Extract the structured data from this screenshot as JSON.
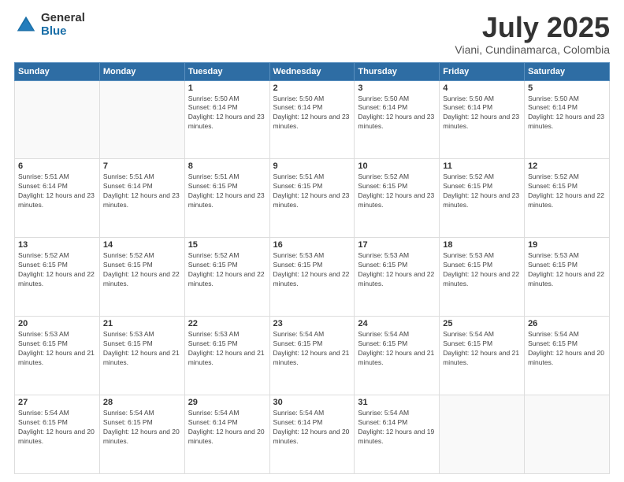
{
  "logo": {
    "general": "General",
    "blue": "Blue"
  },
  "header": {
    "title": "July 2025",
    "subtitle": "Viani, Cundinamarca, Colombia"
  },
  "weekdays": [
    "Sunday",
    "Monday",
    "Tuesday",
    "Wednesday",
    "Thursday",
    "Friday",
    "Saturday"
  ],
  "weeks": [
    [
      {
        "day": "",
        "info": ""
      },
      {
        "day": "",
        "info": ""
      },
      {
        "day": "1",
        "info": "Sunrise: 5:50 AM\nSunset: 6:14 PM\nDaylight: 12 hours and 23 minutes."
      },
      {
        "day": "2",
        "info": "Sunrise: 5:50 AM\nSunset: 6:14 PM\nDaylight: 12 hours and 23 minutes."
      },
      {
        "day": "3",
        "info": "Sunrise: 5:50 AM\nSunset: 6:14 PM\nDaylight: 12 hours and 23 minutes."
      },
      {
        "day": "4",
        "info": "Sunrise: 5:50 AM\nSunset: 6:14 PM\nDaylight: 12 hours and 23 minutes."
      },
      {
        "day": "5",
        "info": "Sunrise: 5:50 AM\nSunset: 6:14 PM\nDaylight: 12 hours and 23 minutes."
      }
    ],
    [
      {
        "day": "6",
        "info": "Sunrise: 5:51 AM\nSunset: 6:14 PM\nDaylight: 12 hours and 23 minutes."
      },
      {
        "day": "7",
        "info": "Sunrise: 5:51 AM\nSunset: 6:14 PM\nDaylight: 12 hours and 23 minutes."
      },
      {
        "day": "8",
        "info": "Sunrise: 5:51 AM\nSunset: 6:15 PM\nDaylight: 12 hours and 23 minutes."
      },
      {
        "day": "9",
        "info": "Sunrise: 5:51 AM\nSunset: 6:15 PM\nDaylight: 12 hours and 23 minutes."
      },
      {
        "day": "10",
        "info": "Sunrise: 5:52 AM\nSunset: 6:15 PM\nDaylight: 12 hours and 23 minutes."
      },
      {
        "day": "11",
        "info": "Sunrise: 5:52 AM\nSunset: 6:15 PM\nDaylight: 12 hours and 23 minutes."
      },
      {
        "day": "12",
        "info": "Sunrise: 5:52 AM\nSunset: 6:15 PM\nDaylight: 12 hours and 22 minutes."
      }
    ],
    [
      {
        "day": "13",
        "info": "Sunrise: 5:52 AM\nSunset: 6:15 PM\nDaylight: 12 hours and 22 minutes."
      },
      {
        "day": "14",
        "info": "Sunrise: 5:52 AM\nSunset: 6:15 PM\nDaylight: 12 hours and 22 minutes."
      },
      {
        "day": "15",
        "info": "Sunrise: 5:52 AM\nSunset: 6:15 PM\nDaylight: 12 hours and 22 minutes."
      },
      {
        "day": "16",
        "info": "Sunrise: 5:53 AM\nSunset: 6:15 PM\nDaylight: 12 hours and 22 minutes."
      },
      {
        "day": "17",
        "info": "Sunrise: 5:53 AM\nSunset: 6:15 PM\nDaylight: 12 hours and 22 minutes."
      },
      {
        "day": "18",
        "info": "Sunrise: 5:53 AM\nSunset: 6:15 PM\nDaylight: 12 hours and 22 minutes."
      },
      {
        "day": "19",
        "info": "Sunrise: 5:53 AM\nSunset: 6:15 PM\nDaylight: 12 hours and 22 minutes."
      }
    ],
    [
      {
        "day": "20",
        "info": "Sunrise: 5:53 AM\nSunset: 6:15 PM\nDaylight: 12 hours and 21 minutes."
      },
      {
        "day": "21",
        "info": "Sunrise: 5:53 AM\nSunset: 6:15 PM\nDaylight: 12 hours and 21 minutes."
      },
      {
        "day": "22",
        "info": "Sunrise: 5:53 AM\nSunset: 6:15 PM\nDaylight: 12 hours and 21 minutes."
      },
      {
        "day": "23",
        "info": "Sunrise: 5:54 AM\nSunset: 6:15 PM\nDaylight: 12 hours and 21 minutes."
      },
      {
        "day": "24",
        "info": "Sunrise: 5:54 AM\nSunset: 6:15 PM\nDaylight: 12 hours and 21 minutes."
      },
      {
        "day": "25",
        "info": "Sunrise: 5:54 AM\nSunset: 6:15 PM\nDaylight: 12 hours and 21 minutes."
      },
      {
        "day": "26",
        "info": "Sunrise: 5:54 AM\nSunset: 6:15 PM\nDaylight: 12 hours and 20 minutes."
      }
    ],
    [
      {
        "day": "27",
        "info": "Sunrise: 5:54 AM\nSunset: 6:15 PM\nDaylight: 12 hours and 20 minutes."
      },
      {
        "day": "28",
        "info": "Sunrise: 5:54 AM\nSunset: 6:15 PM\nDaylight: 12 hours and 20 minutes."
      },
      {
        "day": "29",
        "info": "Sunrise: 5:54 AM\nSunset: 6:14 PM\nDaylight: 12 hours and 20 minutes."
      },
      {
        "day": "30",
        "info": "Sunrise: 5:54 AM\nSunset: 6:14 PM\nDaylight: 12 hours and 20 minutes."
      },
      {
        "day": "31",
        "info": "Sunrise: 5:54 AM\nSunset: 6:14 PM\nDaylight: 12 hours and 19 minutes."
      },
      {
        "day": "",
        "info": ""
      },
      {
        "day": "",
        "info": ""
      }
    ]
  ]
}
